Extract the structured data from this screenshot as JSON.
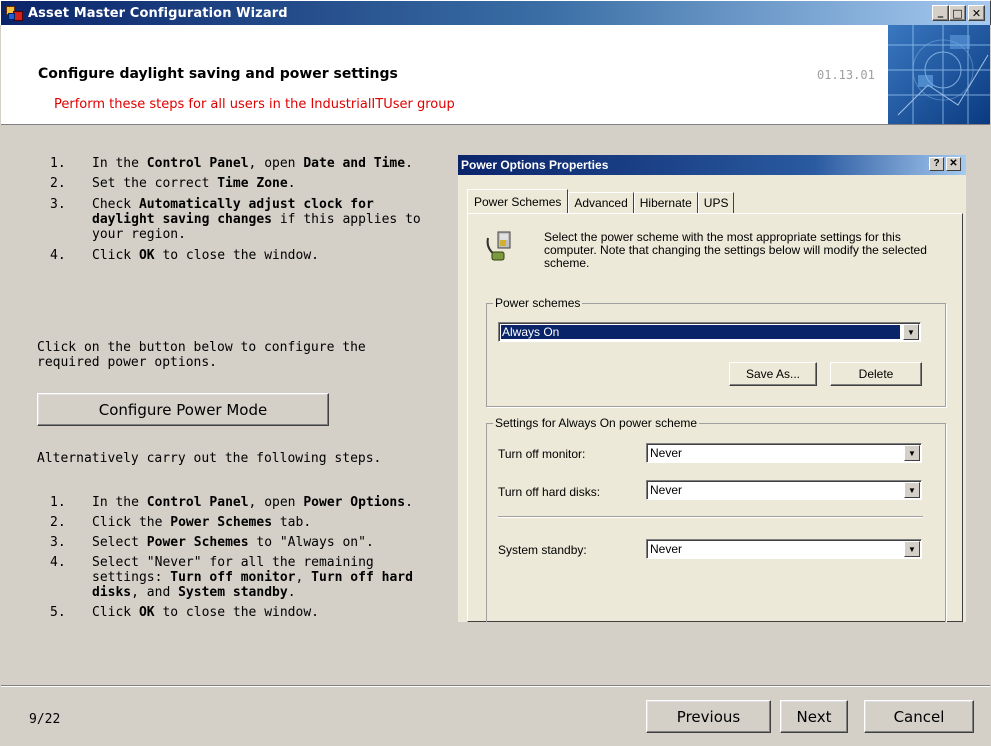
{
  "window": {
    "title": "Asset Master  Configuration Wizard",
    "minimize": "_",
    "maximize": "□",
    "close": "✕"
  },
  "header": {
    "title": "Configure daylight saving and power settings",
    "subtitle": "Perform these steps for all users in the IndustrialITUser group",
    "code": "01.13.01"
  },
  "section1": {
    "steps": [
      {
        "num": "1.",
        "parts": [
          [
            "In the ",
            false
          ],
          [
            "Control Panel",
            true
          ],
          [
            ", open ",
            false
          ],
          [
            "Date and Time",
            true
          ],
          [
            ".",
            false
          ]
        ]
      },
      {
        "num": "2.",
        "parts": [
          [
            "Set the correct ",
            false
          ],
          [
            "Time Zone",
            true
          ],
          [
            ".",
            false
          ]
        ]
      },
      {
        "num": "3.",
        "parts": [
          [
            "Check ",
            false
          ],
          [
            "Automatically adjust clock for daylight saving changes",
            true
          ],
          [
            " if this applies to your region.",
            false
          ]
        ]
      },
      {
        "num": "4.",
        "parts": [
          [
            "Click ",
            false
          ],
          [
            "OK",
            true
          ],
          [
            " to close the window.",
            false
          ]
        ]
      }
    ]
  },
  "para1": "Click on the button below to configure the required power options.",
  "configure_button": "Configure Power Mode",
  "para2": "Alternatively carry out the following steps.",
  "section2": {
    "steps": [
      {
        "num": "1.",
        "parts": [
          [
            "In the ",
            false
          ],
          [
            "Control Panel",
            true
          ],
          [
            ", open ",
            false
          ],
          [
            "Power Options",
            true
          ],
          [
            ".",
            false
          ]
        ]
      },
      {
        "num": "2.",
        "parts": [
          [
            "Click the ",
            false
          ],
          [
            "Power Schemes",
            true
          ],
          [
            " tab.",
            false
          ]
        ]
      },
      {
        "num": "3.",
        "parts": [
          [
            "Select ",
            false
          ],
          [
            "Power Schemes",
            true
          ],
          [
            " to \"Always on\".",
            false
          ]
        ]
      },
      {
        "num": "4.",
        "parts": [
          [
            "Select \"Never\" for all the remaining settings: ",
            false
          ],
          [
            "Turn off monitor",
            true
          ],
          [
            ", ",
            false
          ],
          [
            "Turn off hard disks",
            true
          ],
          [
            ", and ",
            false
          ],
          [
            "System standby",
            true
          ],
          [
            ".",
            false
          ]
        ]
      },
      {
        "num": "5.",
        "parts": [
          [
            "Click ",
            false
          ],
          [
            "OK",
            true
          ],
          [
            " to close the window.",
            false
          ]
        ]
      }
    ]
  },
  "power_options": {
    "title": "Power Options Properties",
    "help": "?",
    "close": "✕",
    "tabs": [
      "Power Schemes",
      "Advanced",
      "Hibernate",
      "UPS"
    ],
    "description": "Select the power scheme with the most appropriate settings for this computer. Note that changing the settings below will modify the selected scheme.",
    "schemes_legend": "Power schemes",
    "selected_scheme": "Always On",
    "save_as": "Save As...",
    "delete": "Delete",
    "settings_legend": "Settings for Always On power scheme",
    "monitor_label": "Turn off monitor:",
    "monitor_value": "Never",
    "disks_label": "Turn off hard disks:",
    "disks_value": "Never",
    "standby_label": "System standby:",
    "standby_value": "Never"
  },
  "footer": {
    "counter": "9/22",
    "previous": "Previous",
    "next": "Next",
    "cancel": "Cancel"
  }
}
